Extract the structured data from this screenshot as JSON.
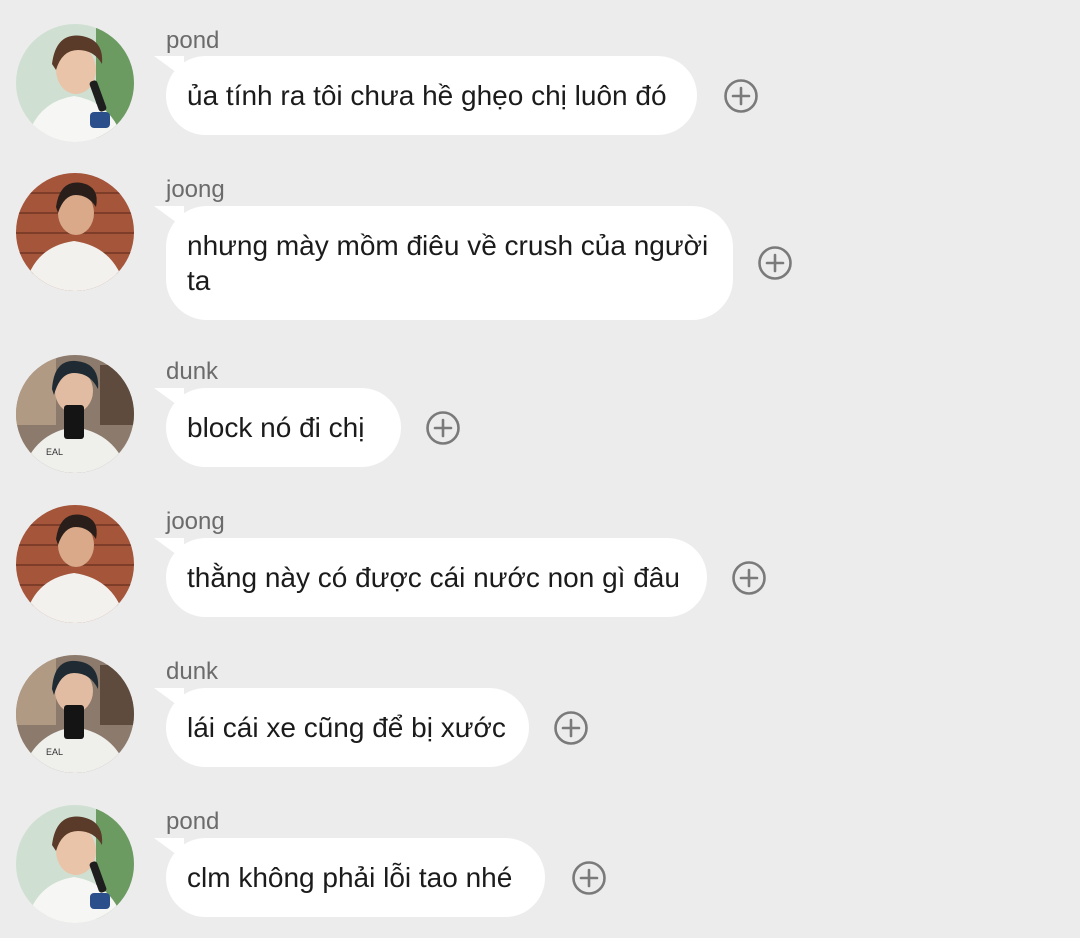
{
  "messages": [
    {
      "sender": "pond",
      "avatar": "pond-avatar",
      "text": "ủa tính ra tôi chưa hề ghẹo chị luôn đó"
    },
    {
      "sender": "joong",
      "avatar": "joong-avatar",
      "text": "nhưng mày mồm điêu về crush của người ta"
    },
    {
      "sender": "dunk",
      "avatar": "dunk-avatar",
      "text": "block nó đi chị"
    },
    {
      "sender": "joong",
      "avatar": "joong-avatar",
      "text": "thằng này có được cái nước non gì đâu"
    },
    {
      "sender": "dunk",
      "avatar": "dunk-avatar",
      "text": "lái cái xe cũng để bị xước"
    },
    {
      "sender": "pond",
      "avatar": "pond-avatar",
      "text": "clm không phải lỗi tao nhé"
    }
  ],
  "icons": {
    "add_reaction": "plus-circle-icon"
  },
  "colors": {
    "background": "#ececec",
    "bubble": "#ffffff",
    "sender_name": "#6b6b6b",
    "icon": "#7a7a7a"
  }
}
